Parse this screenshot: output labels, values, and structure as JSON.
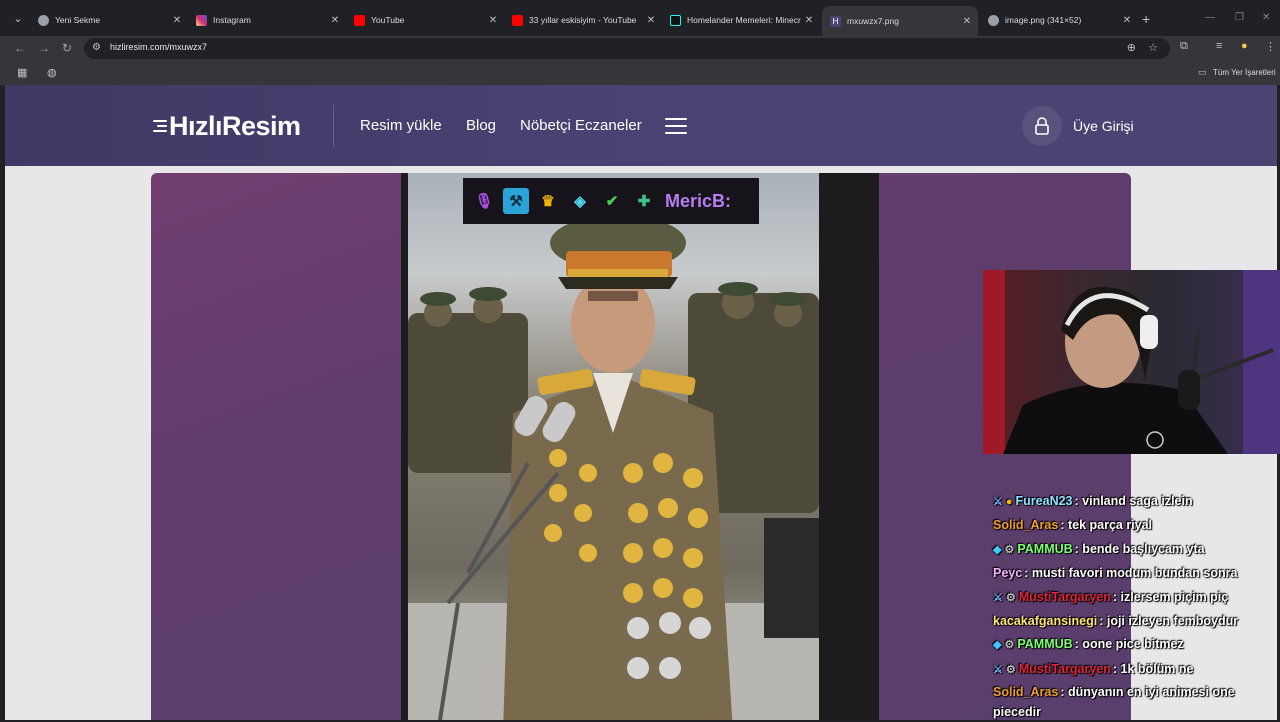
{
  "browser": {
    "tabs": [
      {
        "title": "Yeni Sekme",
        "favicon_color": "#9aa0a6",
        "active": false
      },
      {
        "title": "Instagram",
        "favicon_color": "#d62976",
        "active": false
      },
      {
        "title": "YouTube",
        "favicon_color": "#ff0000",
        "active": false
      },
      {
        "title": "33 yıllar eskisiyim - YouTube",
        "favicon_color": "#ff0000",
        "active": false
      },
      {
        "title": "Homelander Memeleri: Minecr",
        "favicon_color": "#25f4ee",
        "active": false
      },
      {
        "title": "mxuwzx7.png",
        "favicon_color": "#4a4374",
        "active": true
      },
      {
        "title": "image.png (341×52)",
        "favicon_color": "#9aa0a6",
        "active": false
      }
    ],
    "url": "hizliresim.com/mxuwzx7",
    "bookmarks_label": "Tüm Yer İşaretleri",
    "icons": [
      "tab-search-icon",
      "back-icon",
      "forward-icon",
      "reload-icon",
      "site-info-icon",
      "zoom-icon",
      "bookmark-star-icon",
      "extensions-icon",
      "media-icon",
      "profile-icon",
      "menu-icon"
    ]
  },
  "site": {
    "logo_text": "HızlıResim",
    "nav": {
      "upload": "Resim yükle",
      "blog": "Blog",
      "pharmacies": "Nöbetçi Eczaneler"
    },
    "login": "Üye Girişi",
    "brand_color": "#4a4374"
  },
  "stream_badges": {
    "name": "MericB:",
    "icons": [
      "mic-icon",
      "hammer-icon",
      "crown-icon",
      "game-icon",
      "verified-icon",
      "plus-icon"
    ]
  },
  "chat": [
    {
      "badges": [
        "sword-icon",
        "coin-icon"
      ],
      "user": "FureaN23",
      "color": "#8fe3ff",
      "message": ": vinland saga izlein"
    },
    {
      "badges": [],
      "user": "Solid_Aras",
      "color": "#f0a030",
      "message": ": tek parça riyal"
    },
    {
      "badges": [
        "gem-icon",
        "gear-badge-icon"
      ],
      "user": "PAMMUB",
      "color": "#7dff73",
      "message": ": bende başlıycam yta"
    },
    {
      "badges": [],
      "user": "Peyc",
      "color": "#f4b6ff",
      "message": ": musti favori modum bundan sonra"
    },
    {
      "badges": [
        "sword-icon",
        "gear-badge-icon"
      ],
      "user": "MustiTargaryen",
      "color": "#e0253b",
      "message": ": izlersem piçim piç"
    },
    {
      "badges": [],
      "user": "kacakafgansinegi",
      "color": "#ffe27a",
      "message": ": joji izleyen femboydur"
    },
    {
      "badges": [
        "gem-icon",
        "gear-badge-icon"
      ],
      "user": "PAMMUB",
      "color": "#7dff73",
      "message": ": oone pice bitmez"
    },
    {
      "badges": [
        "sword-icon",
        "gear-badge-icon"
      ],
      "user": "MustiTargaryen",
      "color": "#e0253b",
      "message": ": 1k bölüm ne"
    },
    {
      "badges": [],
      "user": "Solid_Aras",
      "color": "#f0a030",
      "message": ": dünyanın en iyi animesi one piecedir"
    }
  ]
}
